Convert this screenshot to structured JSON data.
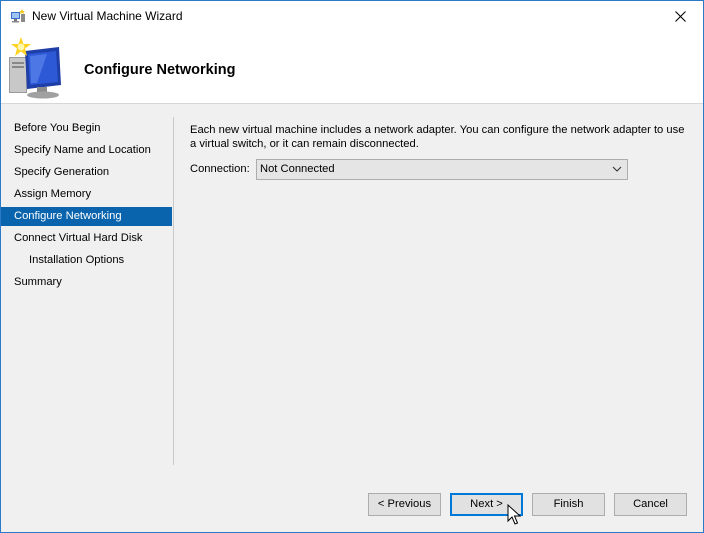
{
  "window": {
    "title": "New Virtual Machine Wizard"
  },
  "header": {
    "title": "Configure Networking"
  },
  "sidebar": {
    "items": [
      {
        "label": "Before You Begin"
      },
      {
        "label": "Specify Name and Location"
      },
      {
        "label": "Specify Generation"
      },
      {
        "label": "Assign Memory"
      },
      {
        "label": "Configure Networking"
      },
      {
        "label": "Connect Virtual Hard Disk"
      },
      {
        "label": "Installation Options"
      },
      {
        "label": "Summary"
      }
    ]
  },
  "content": {
    "description": "Each new virtual machine includes a network adapter. You can configure the network adapter to use a virtual switch, or it can remain disconnected.",
    "connection_label": "Connection:",
    "connection_value": "Not Connected"
  },
  "buttons": {
    "previous": "< Previous",
    "next": "Next >",
    "finish": "Finish",
    "cancel": "Cancel"
  },
  "colors": {
    "accent": "#0a64ad",
    "window_border": "#2b79c7"
  }
}
